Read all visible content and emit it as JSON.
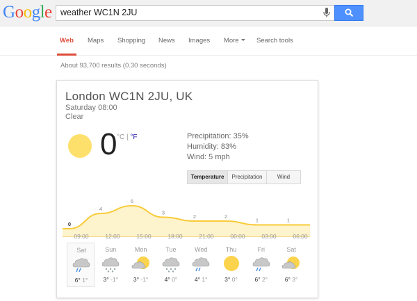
{
  "logo": {
    "letters": [
      "G",
      "o",
      "o",
      "g",
      "l",
      "e"
    ],
    "colors": [
      "#4285f4",
      "#ea4335",
      "#fbbc05",
      "#4285f4",
      "#34a853",
      "#ea4335"
    ]
  },
  "search": {
    "query": "weather WC1N 2JU"
  },
  "tabs": [
    "Web",
    "Maps",
    "Shopping",
    "News",
    "Images",
    "More",
    "Search tools"
  ],
  "stats": "About 93,700 results (0.30 seconds)",
  "weather": {
    "location": "London WC1N 2JU, UK",
    "time": "Saturday 08:00",
    "condition": "Clear",
    "temp": "0",
    "unit_c": "°C",
    "unit_sep": "|",
    "unit_f": "°F",
    "precipitation": "Precipitation: 35%",
    "humidity": "Humidity: 83%",
    "wind": "Wind: 5 mph",
    "buttons": [
      "Temperature",
      "Precipitation",
      "Wind"
    ],
    "accent": "#f9cb3a"
  },
  "chart_data": {
    "type": "area",
    "x": [
      "09:00",
      "12:00",
      "15:00",
      "18:00",
      "21:00",
      "00:00",
      "03:00",
      "06:00"
    ],
    "y": [
      0,
      4,
      6,
      3,
      2,
      2,
      1,
      1
    ],
    "labels": [
      "0",
      "4",
      "6",
      "3",
      "2",
      "2",
      "1",
      "1"
    ]
  },
  "forecast": [
    {
      "day": "Sat",
      "icon": "rain-cloud-icon",
      "hi": "6°",
      "lo": "1°"
    },
    {
      "day": "Sun",
      "icon": "snow-cloud-icon",
      "hi": "3°",
      "lo": "-1°"
    },
    {
      "day": "Mon",
      "icon": "partly-cloudy-icon",
      "hi": "3°",
      "lo": "-1°"
    },
    {
      "day": "Tue",
      "icon": "snow-cloud-icon",
      "hi": "4°",
      "lo": "0°"
    },
    {
      "day": "Wed",
      "icon": "rain-cloud-icon",
      "hi": "4°",
      "lo": "1°"
    },
    {
      "day": "Thu",
      "icon": "sun-icon",
      "hi": "3°",
      "lo": "0°"
    },
    {
      "day": "Fri",
      "icon": "rain-cloud-icon",
      "hi": "6°",
      "lo": "2°"
    },
    {
      "day": "Sat",
      "icon": "partly-cloudy-icon",
      "hi": "6°",
      "lo": "3°"
    }
  ]
}
